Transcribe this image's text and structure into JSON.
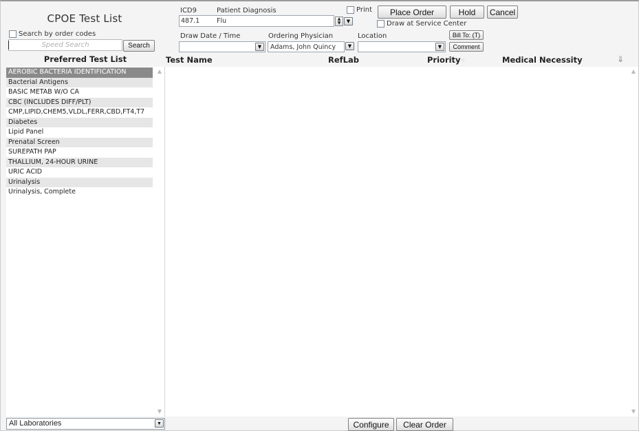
{
  "left_panel": {
    "title": "CPOE Test List",
    "search_by_codes_label": "Search by order codes",
    "speed_search_placeholder": "Speed Search",
    "search_button": "Search"
  },
  "header": {
    "icd9_label": "ICD9",
    "icd9_value": "487.1",
    "diagnosis_label": "Patient Diagnosis",
    "diagnosis_value": "Flu",
    "print_label": "Print",
    "place_order_button": "Place Order",
    "hold_button": "Hold",
    "cancel_button": "Cancel",
    "draw_at_service_label": "Draw at Service Center",
    "draw_date_label": "Draw Date / Time",
    "draw_date_value": "",
    "physician_label": "Ordering Physician",
    "physician_value": "Adams, John Quincy",
    "location_label": "Location",
    "location_value": "",
    "bill_to_button": "Bill To: (T)",
    "comment_button": "Comment"
  },
  "columns": {
    "preferred": "Preferred Test List",
    "test_name": "Test Name",
    "reflab": "RefLab",
    "priority": "Priority",
    "medical_necessity": "Medical Necessity",
    "sort_icon_glyph": "⇓"
  },
  "preferred_tests": [
    "AEROBIC BACTERIA IDENTIFICATION",
    "Bacterial Antigens",
    "BASIC METAB W/O CA",
    "CBC (INCLUDES DIFF/PLT)",
    "CMP,LIPID,CHEM5,VLDL,FERR,CBD,FT4,T7",
    "Diabetes",
    "Lipid Panel",
    "Prenatal Screen",
    "SUREPATH PAP",
    "THALLIUM, 24-HOUR URINE",
    "URIC ACID",
    "Urinalysis",
    "Urinalysis, Complete"
  ],
  "selected_index": 0,
  "footer": {
    "laboratory_select": "All Laboratories",
    "configure_button": "Configure",
    "clear_order_button": "Clear Order"
  },
  "colors": {
    "selected_row": "#8a8a8a",
    "alt_row": "#e6e6e6",
    "background": "#f4f4f4"
  }
}
